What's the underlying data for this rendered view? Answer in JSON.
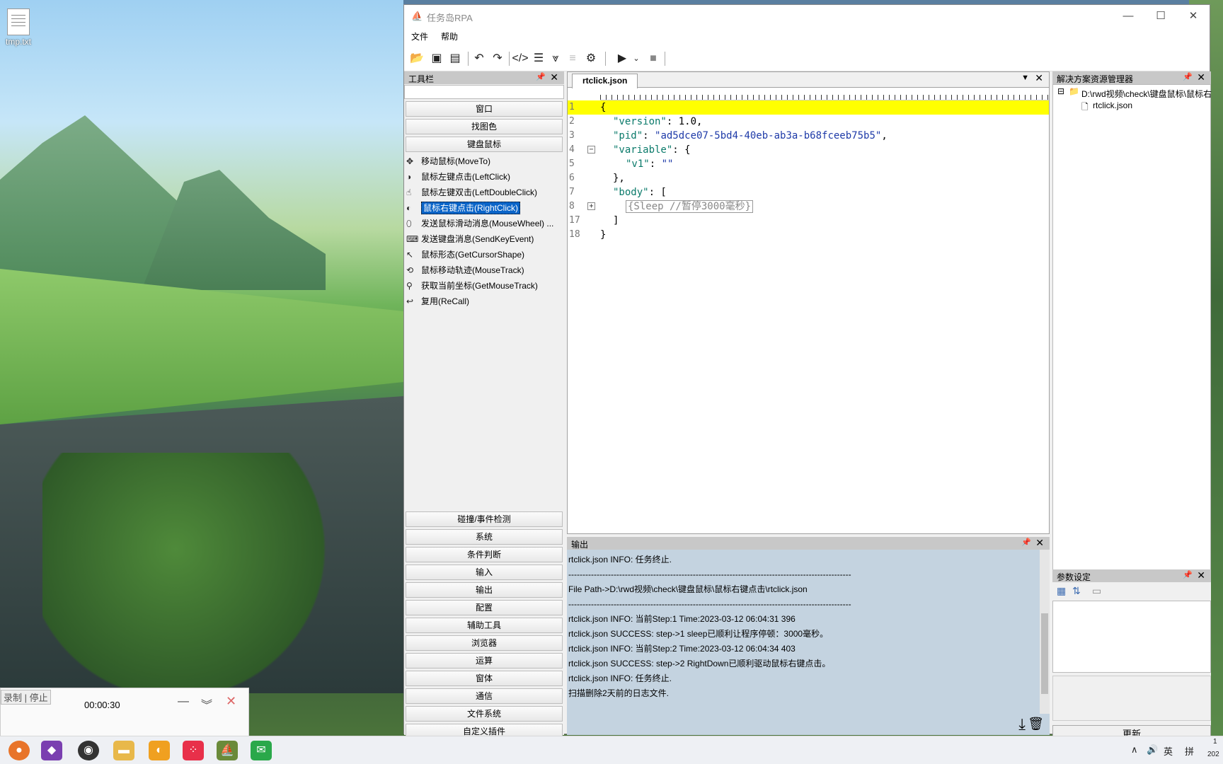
{
  "desktop": {
    "icon_label": "tmp.txt"
  },
  "recorder": {
    "label": "录制 | 停止",
    "time": "00:00:30"
  },
  "window": {
    "title": "任务岛RPA",
    "menu": [
      "文件",
      "帮助"
    ]
  },
  "toolbox": {
    "header": "工具栏",
    "top_categories": [
      "窗口",
      "找图色",
      "键盘鼠标"
    ],
    "items": [
      {
        "icon": "move-mouse-icon",
        "label": "移动鼠标(MoveTo)"
      },
      {
        "icon": "left-click-icon",
        "label": "鼠标左键点击(LeftClick)"
      },
      {
        "icon": "double-click-icon",
        "label": "鼠标左键双击(LeftDoubleClick)"
      },
      {
        "icon": "right-click-icon",
        "label": "鼠标右键点击(RightClick)"
      },
      {
        "icon": "mouse-wheel-icon",
        "label": "发送鼠标滑动消息(MouseWheel) ..."
      },
      {
        "icon": "keyboard-icon",
        "label": "发送键盘消息(SendKeyEvent)"
      },
      {
        "icon": "cursor-shape-icon",
        "label": "鼠标形态(GetCursorShape)"
      },
      {
        "icon": "mouse-track-icon",
        "label": "鼠标移动轨迹(MouseTrack)"
      },
      {
        "icon": "pin-icon",
        "label": "获取当前坐标(GetMouseTrack)"
      },
      {
        "icon": "recall-icon",
        "label": "复用(ReCall)"
      }
    ],
    "selected_index": 3,
    "bottom_categories": [
      "碰撞/事件检测",
      "系统",
      "条件判断",
      "输入",
      "输出",
      "配置",
      "辅助工具",
      "浏览器",
      "运算",
      "窗体",
      "通信",
      "文件系统",
      "自定义插件"
    ]
  },
  "editor": {
    "tab": "rtclick.json",
    "lines": [
      {
        "n": "1",
        "text": "{"
      },
      {
        "n": "2",
        "key": "\"version\"",
        "rest": ": 1.0,"
      },
      {
        "n": "3",
        "key": "\"pid\"",
        "rest": ": ",
        "str": "\"ad5dce07-5bd4-40eb-ab3a-b68fceeb75b5\"",
        "end": ","
      },
      {
        "n": "4",
        "key": "\"variable\"",
        "rest": ": {"
      },
      {
        "n": "5",
        "key": "\"v1\"",
        "rest": ": ",
        "str": "\"\""
      },
      {
        "n": "6",
        "text": "},"
      },
      {
        "n": "7",
        "key": "\"body\"",
        "rest": ": ["
      },
      {
        "n": "8",
        "sleep": "{Sleep //暂停3000毫秒}"
      },
      {
        "n": "17",
        "text": "]"
      },
      {
        "n": "18",
        "text": "}"
      }
    ]
  },
  "output": {
    "header": "输出",
    "lines": [
      "rtclick.json INFO: 任务终止.",
      "----------------------------------------------------------------------------------------------------",
      "File Path->D:\\rwd视频\\check\\键盘鼠标\\鼠标右键点击\\rtclick.json",
      "----------------------------------------------------------------------------------------------------",
      "rtclick.json INFO:  当前Step:1  Time:2023-03-12 06:04:31 396",
      "rtclick.json SUCCESS:  step->1   sleep已顺利让程序停顿：3000毫秒。",
      "rtclick.json INFO:  当前Step:2  Time:2023-03-12 06:04:34 403",
      "rtclick.json SUCCESS:  step->2   RightDown已顺利驱动鼠标右键点击。",
      "rtclick.json INFO: 任务终止.",
      "扫描删除2天前的日志文件."
    ]
  },
  "solution": {
    "header": "解决方案资源管理器",
    "root": "D:\\rwd视频\\check\\键盘鼠标\\鼠标右",
    "file": "rtclick.json"
  },
  "params": {
    "header": "参数设定",
    "update": "更新"
  },
  "taskbar": {
    "ime": "英",
    "layout": "拼",
    "clock_top": "1",
    "clock_bottom": "202"
  }
}
